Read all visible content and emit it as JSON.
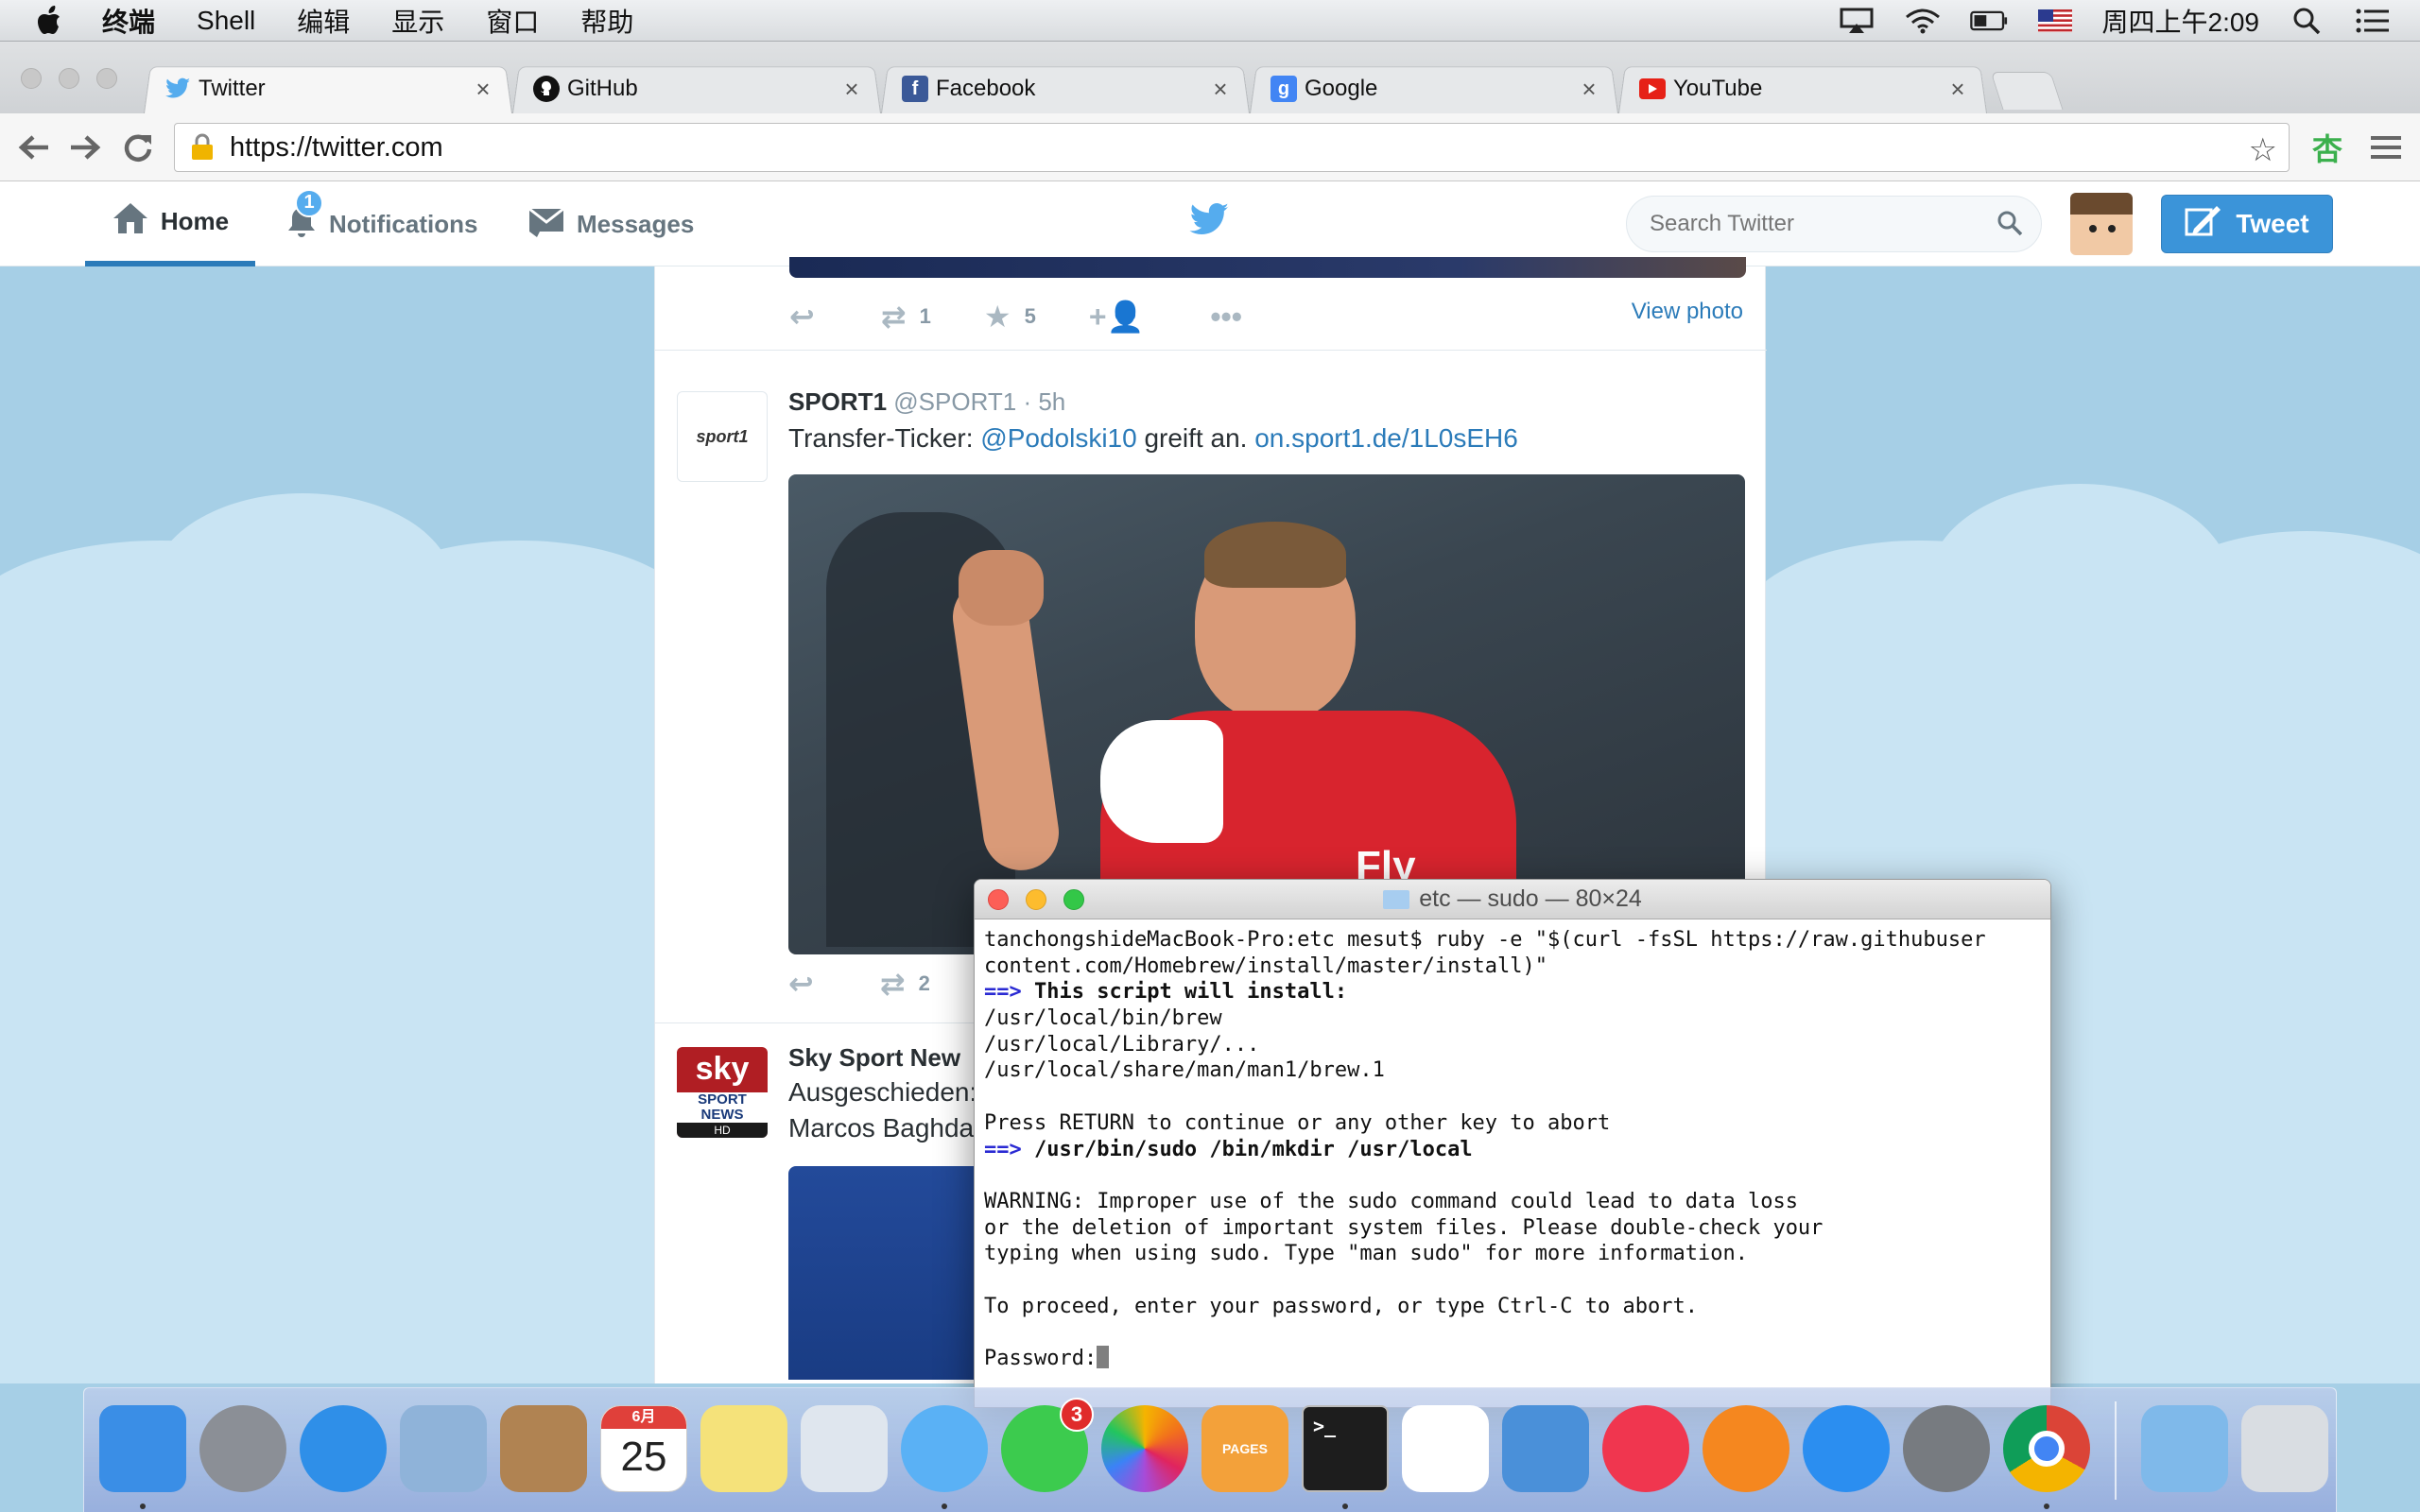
{
  "menubar": {
    "app_name": "终端",
    "items": [
      "Shell",
      "编辑",
      "显示",
      "窗口",
      "帮助"
    ],
    "clock": "周四上午2:09"
  },
  "browser": {
    "tabs": [
      {
        "label": "Twitter",
        "icon": "twitter-icon",
        "color": "#55acee",
        "active": true
      },
      {
        "label": "GitHub",
        "icon": "github-icon",
        "color": "#111111",
        "active": false
      },
      {
        "label": "Facebook",
        "icon": "facebook-icon",
        "color": "#3b5998",
        "active": false
      },
      {
        "label": "Google",
        "icon": "google-icon",
        "color": "#4285f4",
        "active": false
      },
      {
        "label": "YouTube",
        "icon": "youtube-icon",
        "color": "#e62117",
        "active": false
      }
    ],
    "close_glyph": "×",
    "url": "https://twitter.com"
  },
  "twitter": {
    "nav": {
      "home": "Home",
      "notifications": "Notifications",
      "notifications_count": "1",
      "messages": "Messages"
    },
    "search_placeholder": "Search Twitter",
    "tweet_button": "Tweet",
    "tweet_prev": {
      "retweets": "1",
      "favorites": "5",
      "view_photo": "View photo"
    },
    "tweet_sport1": {
      "name": "SPORT1",
      "handle": "@SPORT1",
      "time": "· 5h",
      "avatar_text": "sport1",
      "text_prefix": "Transfer-Ticker: ",
      "mention": "@Podolski10",
      "text_mid": " greift an. ",
      "link": "on.sport1.de/1L0sEH6",
      "retweets": "2",
      "jersey_text": "Fly"
    },
    "tweet_sky": {
      "name": "Sky Sport New",
      "line1": "Ausgeschieden:",
      "line2": "Marcos Baghda",
      "avatar_sky": "sky",
      "avatar_sport": "SPORT",
      "avatar_news": "NEWS",
      "avatar_hd": "HD"
    }
  },
  "terminal": {
    "title": "etc — sudo — 80×24",
    "lines": [
      {
        "type": "plain",
        "text": "tanchongshideMacBook-Pro:etc mesut$ ruby -e \"$(curl -fsSL https://raw.githubuser"
      },
      {
        "type": "plain",
        "text": "content.com/Homebrew/install/master/install)\""
      },
      {
        "type": "arrow",
        "arrow": "==>",
        "text": " This script will install:"
      },
      {
        "type": "plain",
        "text": "/usr/local/bin/brew"
      },
      {
        "type": "plain",
        "text": "/usr/local/Library/..."
      },
      {
        "type": "plain",
        "text": "/usr/local/share/man/man1/brew.1"
      },
      {
        "type": "plain",
        "text": ""
      },
      {
        "type": "plain",
        "text": "Press RETURN to continue or any other key to abort"
      },
      {
        "type": "arrow",
        "arrow": "==>",
        "text": " /usr/bin/sudo /bin/mkdir /usr/local"
      },
      {
        "type": "plain",
        "text": ""
      },
      {
        "type": "plain",
        "text": "WARNING: Improper use of the sudo command could lead to data loss"
      },
      {
        "type": "plain",
        "text": "or the deletion of important system files. Please double-check your"
      },
      {
        "type": "plain",
        "text": "typing when using sudo. Type \"man sudo\" for more information."
      },
      {
        "type": "plain",
        "text": ""
      },
      {
        "type": "plain",
        "text": "To proceed, enter your password, or type Ctrl-C to abort."
      },
      {
        "type": "plain",
        "text": ""
      }
    ],
    "prompt": "Password:"
  },
  "dock": {
    "calendar_month": "6月",
    "calendar_day": "25",
    "facetime_badge": "3",
    "terminal_prompt": ">_",
    "pages_label": "PAGES",
    "items": [
      {
        "name": "finder-icon",
        "color": "#3a8ee6",
        "running": true
      },
      {
        "name": "launchpad-icon",
        "color": "#8b8f96",
        "running": false
      },
      {
        "name": "safari-icon",
        "color": "#2f8fe8",
        "running": false
      },
      {
        "name": "mail-icon",
        "color": "#8fb3d9",
        "running": false
      },
      {
        "name": "contacts-icon",
        "color": "#b08352",
        "running": false
      },
      {
        "name": "calendar-icon",
        "color": "#ffffff",
        "running": false
      },
      {
        "name": "notes-icon",
        "color": "#f5e27a",
        "running": false
      },
      {
        "name": "preview-icon",
        "color": "#dfe6ee",
        "running": false
      },
      {
        "name": "messages-icon",
        "color": "#5ab1f5",
        "running": true
      },
      {
        "name": "facetime-icon",
        "color": "#3ccb4e",
        "running": false
      },
      {
        "name": "photos-icon",
        "color": "#ffffff",
        "running": false
      },
      {
        "name": "pages-icon",
        "color": "#f3a13a",
        "running": false
      },
      {
        "name": "terminal-icon",
        "color": "#1d1d1d",
        "running": true
      },
      {
        "name": "numbers-icon",
        "color": "#ffffff",
        "running": false
      },
      {
        "name": "keynote-icon",
        "color": "#4a90d9",
        "running": false
      },
      {
        "name": "itunes-icon",
        "color": "#f0364f",
        "running": false
      },
      {
        "name": "ibooks-icon",
        "color": "#f5871f",
        "running": false
      },
      {
        "name": "app-store-icon",
        "color": "#2b8ef0",
        "running": false
      },
      {
        "name": "system-preferences-icon",
        "color": "#777b80",
        "running": false
      },
      {
        "name": "chrome-icon",
        "color": "#ffffff",
        "running": true
      },
      {
        "name": "downloads-folder-icon",
        "color": "#7fb9ea",
        "running": false
      },
      {
        "name": "trash-icon",
        "color": "#d9dde2",
        "running": false
      }
    ]
  }
}
